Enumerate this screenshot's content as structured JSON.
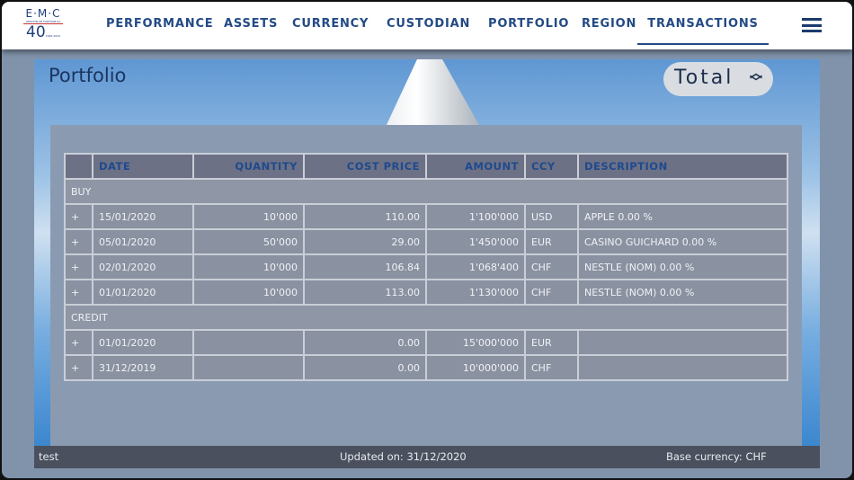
{
  "logo": {
    "brand": "E·M·C",
    "tagline": "GESTION DE FORTUNE SA",
    "anniversary": "40",
    "years": "1982-2022"
  },
  "nav": [
    "PERFORMANCE",
    "ASSETS",
    "CURRENCY",
    "CUSTODIAN",
    "PORTFOLIO",
    "REGION",
    "TRANSACTIONS"
  ],
  "active_nav": "TRANSACTIONS",
  "page_title": "Portfolio",
  "selector": {
    "value": "Total",
    "icon": "chevron-up-down-icon"
  },
  "table": {
    "headers": [
      "",
      "DATE",
      "QUANTITY",
      "COST PRICE",
      "AMOUNT",
      "CCY",
      "DESCRIPTION"
    ],
    "groups": [
      {
        "label": "BUY",
        "rows": [
          [
            "+",
            "15/01/2020",
            "10'000",
            "110.00",
            "1'100'000",
            "USD",
            "APPLE 0.00 %"
          ],
          [
            "+",
            "05/01/2020",
            "50'000",
            "29.00",
            "1'450'000",
            "EUR",
            "CASINO GUICHARD 0.00 %"
          ],
          [
            "+",
            "02/01/2020",
            "10'000",
            "106.84",
            "1'068'400",
            "CHF",
            "NESTLE (NOM) 0.00 %"
          ],
          [
            "+",
            "01/01/2020",
            "10'000",
            "113.00",
            "1'130'000",
            "CHF",
            "NESTLE (NOM) 0.00 %"
          ]
        ]
      },
      {
        "label": "CREDIT",
        "rows": [
          [
            "+",
            "01/01/2020",
            "",
            "0.00",
            "15'000'000",
            "EUR",
            ""
          ],
          [
            "+",
            "31/12/2019",
            "",
            "0.00",
            "10'000'000",
            "CHF",
            ""
          ]
        ]
      }
    ]
  },
  "footer": {
    "left": "test",
    "center": "Updated on: 31/12/2020",
    "right": "Base currency: CHF"
  }
}
